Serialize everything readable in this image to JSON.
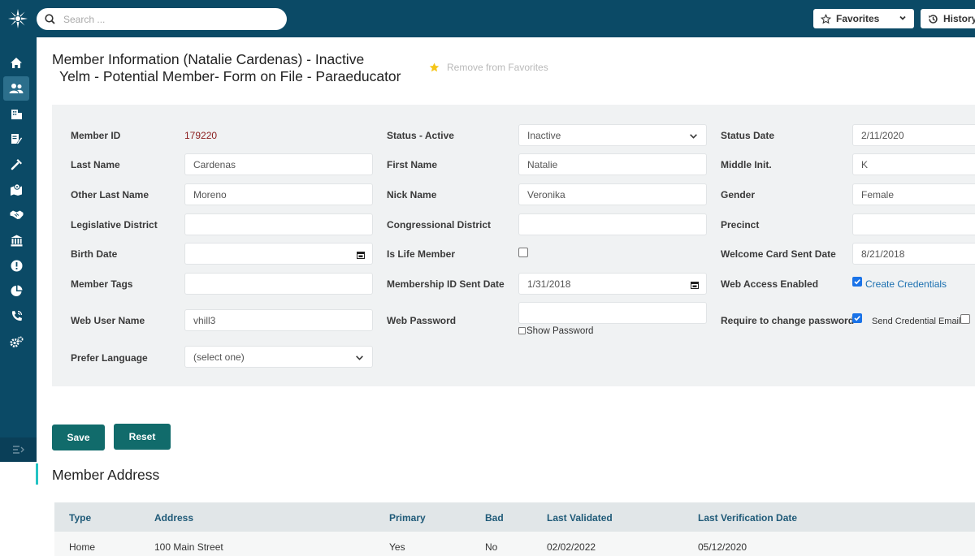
{
  "topbar": {
    "search_placeholder": "Search ...",
    "favorites_label": "Favorites",
    "history_label": "History"
  },
  "sidebar": {
    "icons": [
      "home-icon",
      "members-icon",
      "building-icon",
      "edit-document-icon",
      "tools-icon",
      "map-icon",
      "handshake-icon",
      "bank-icon",
      "alert-icon",
      "pie-chart-icon",
      "phone-icon",
      "settings-icon",
      "collapse-menu-icon"
    ],
    "active_index": 1
  },
  "header": {
    "title_line1": "Member Information (Natalie Cardenas) - Inactive",
    "title_line2": "Yelm - Potential Member- Form on File - Paraeducator",
    "remove_favorites": "Remove from Favorites"
  },
  "form": {
    "member_id_label": "Member ID",
    "member_id": "179220",
    "status_label": "Status - Active",
    "status_value": "Inactive",
    "status_date_label": "Status Date",
    "status_date": "2/11/2020",
    "last_name_label": "Last Name",
    "last_name": "Cardenas",
    "first_name_label": "First Name",
    "first_name": "Natalie",
    "middle_init_label": "Middle Init.",
    "middle_init": "K",
    "other_last_name_label": "Other Last Name",
    "other_last_name": "Moreno",
    "nick_name_label": "Nick Name",
    "nick_name": "Veronika",
    "gender_label": "Gender",
    "gender": "Female",
    "legislative_district_label": "Legislative District",
    "legislative_district": "",
    "congressional_district_label": "Congressional District",
    "congressional_district": "",
    "precinct_label": "Precinct",
    "precinct": "",
    "birth_date_label": "Birth Date",
    "birth_date": "",
    "is_life_member_label": "Is Life Member",
    "is_life_member": false,
    "welcome_card_label": "Welcome Card Sent Date",
    "welcome_card_date": "8/21/2018",
    "member_tags_label": "Member Tags",
    "member_tags": "",
    "membership_id_sent_label": "Membership ID Sent Date",
    "membership_id_sent_date": "1/31/2018",
    "web_access_label": "Web Access Enabled",
    "web_access_enabled": true,
    "create_credentials": "Create Credentials",
    "web_user_name_label": "Web User Name",
    "web_user_name": "vhill3",
    "web_password_label": "Web Password",
    "web_password": "",
    "show_password": "Show Password",
    "require_change_label": "Require to change password",
    "require_change": true,
    "send_credential_email": "Send Credential Email",
    "send_credential": false,
    "prefer_language_label": "Prefer Language",
    "prefer_language": "(select one)"
  },
  "actions": {
    "save": "Save",
    "reset": "Reset"
  },
  "address": {
    "section_title": "Member Address",
    "columns": [
      "Type",
      "Address",
      "Primary",
      "Bad",
      "Last Validated",
      "Last Verification Date"
    ],
    "rows": [
      [
        "Home",
        "100 Main Street",
        "Yes",
        "No",
        "02/02/2022",
        "05/12/2020"
      ]
    ]
  },
  "colors": {
    "navy": "#0b4a66",
    "teal_button": "#116b6b",
    "accent_bar": "#23c3c3",
    "star": "#f5c518"
  }
}
